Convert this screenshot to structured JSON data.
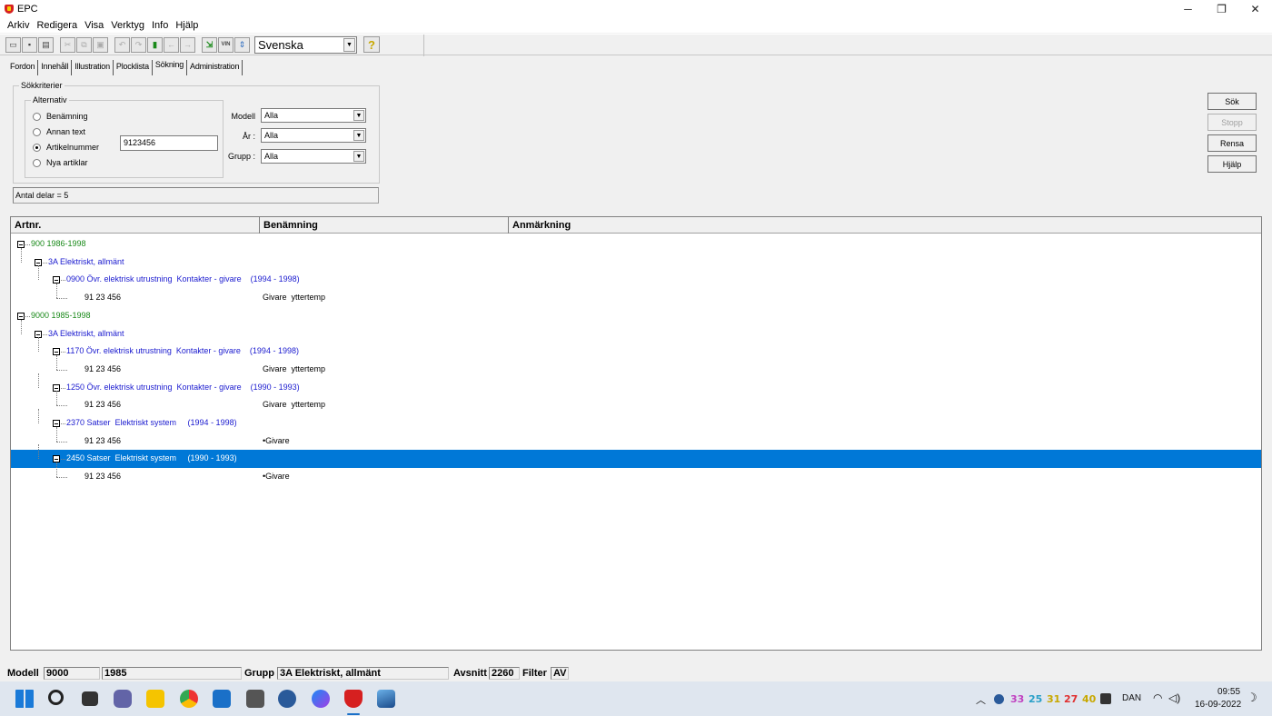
{
  "window": {
    "title": "EPC"
  },
  "menu": [
    "Arkiv",
    "Redigera",
    "Visa",
    "Verktyg",
    "Info",
    "Hjälp"
  ],
  "toolbar": {
    "language": "Svenska",
    "vin_label": "VIN"
  },
  "tabs": [
    "Fordon",
    "Innehåll",
    "Illustration",
    "Plocklista",
    "Sökning",
    "Administration"
  ],
  "criteria": {
    "group_title": "Sökkriterier",
    "alt_title": "Alternativ",
    "options": [
      "Benämning",
      "Annan text",
      "Artikelnummer",
      "Nya artiklar"
    ],
    "selected_option": "Artikelnummer",
    "article_value": "9123456",
    "modell_label": "Modell",
    "modell_value": "Alla",
    "ar_label": "År :",
    "ar_value": "Alla",
    "grupp_label": "Grupp :",
    "grupp_value": "Alla",
    "count_text": "Antal delar = 5"
  },
  "buttons": {
    "sok": "Sök",
    "stopp": "Stopp",
    "rensa": "Rensa",
    "hjalp": "Hjälp"
  },
  "grid": {
    "columns": [
      "Artnr.",
      "Benämning",
      "Anmärkning"
    ],
    "rows": [
      {
        "type": "node",
        "level": 0,
        "text": "900 1986-1998",
        "color": "green"
      },
      {
        "type": "node",
        "level": 1,
        "text": "3A Elektriskt, allmänt",
        "color": "blue"
      },
      {
        "type": "node",
        "level": 2,
        "text": "0900 Övr. elektrisk utrustning  Kontakter - givare    (1994 - 1998)",
        "color": "blue"
      },
      {
        "type": "leaf",
        "level": 3,
        "artnr": "91 23 456",
        "benamning": "Givare  yttertemp"
      },
      {
        "type": "node",
        "level": 0,
        "text": "9000 1985-1998",
        "color": "green"
      },
      {
        "type": "node",
        "level": 1,
        "text": "3A Elektriskt, allmänt",
        "color": "blue"
      },
      {
        "type": "node",
        "level": 2,
        "text": "1170 Övr. elektrisk utrustning  Kontakter - givare    (1994 - 1998)",
        "color": "blue"
      },
      {
        "type": "leaf",
        "level": 3,
        "artnr": "91 23 456",
        "benamning": "Givare  yttertemp"
      },
      {
        "type": "node",
        "level": 2,
        "text": "1250 Övr. elektrisk utrustning  Kontakter - givare    (1990 - 1993)",
        "color": "blue"
      },
      {
        "type": "leaf",
        "level": 3,
        "artnr": "91 23 456",
        "benamning": "Givare  yttertemp"
      },
      {
        "type": "node",
        "level": 2,
        "text": "2370 Satser  Elektriskt system     (1994 - 1998)",
        "color": "blue"
      },
      {
        "type": "leaf",
        "level": 3,
        "artnr": "91 23 456",
        "benamning": "•Givare"
      },
      {
        "type": "node",
        "level": 2,
        "text": "2450 Satser  Elektriskt system     (1990 - 1993)",
        "color": "blue",
        "selected": true
      },
      {
        "type": "leaf",
        "level": 3,
        "artnr": "91 23 456",
        "benamning": "•Givare"
      }
    ]
  },
  "status": {
    "modell_label": "Modell",
    "modell": "9000",
    "year": "1985",
    "grupp_label": "Grupp",
    "grupp": "3A Elektriskt, allmänt",
    "avsnitt_label": "Avsnitt",
    "avsnitt": "2260",
    "filter_label": "Filter",
    "filter": "AV"
  },
  "taskbar": {
    "tray_numbers": [
      {
        "value": "33",
        "color": "#c040c0"
      },
      {
        "value": "25",
        "color": "#2aa0c8"
      },
      {
        "value": "31",
        "color": "#c8a800"
      },
      {
        "value": "27",
        "color": "#e03030"
      },
      {
        "value": "40",
        "color": "#c8a800"
      }
    ],
    "lang": "DAN",
    "time": "09:55",
    "date": "16-09-2022"
  }
}
